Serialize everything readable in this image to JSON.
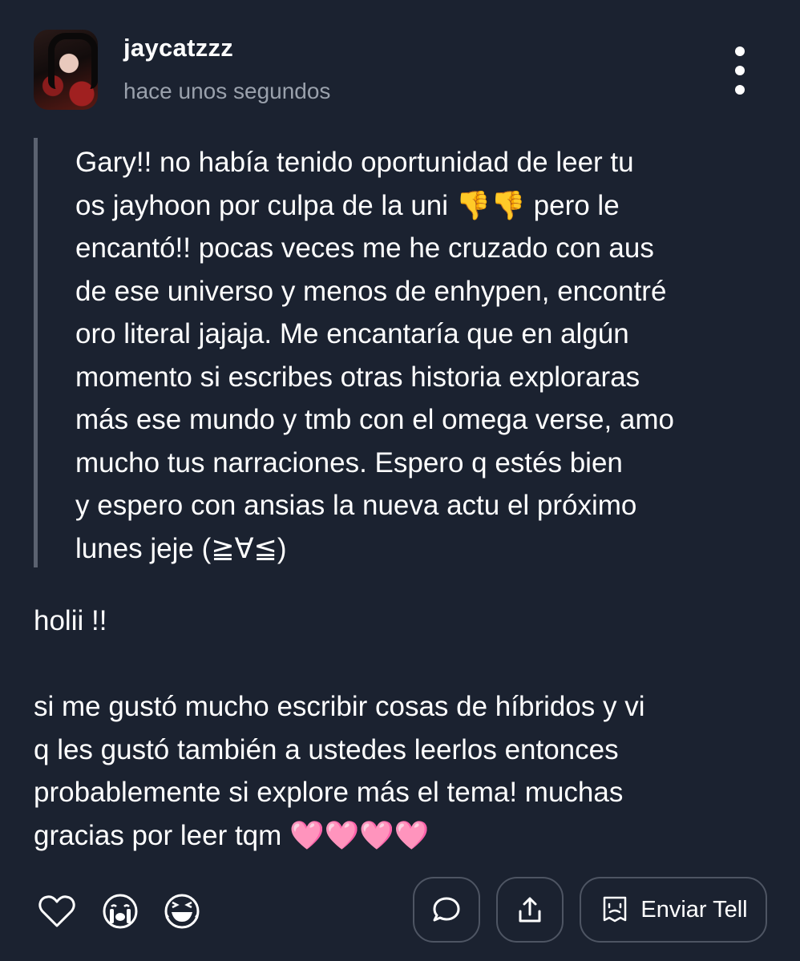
{
  "post": {
    "username": "jaycatzzz",
    "timestamp": "hace unos segundos"
  },
  "quoted_comment": {
    "text": "Gary!! no había tenido oportunidad de leer tu\nos jayhoon por culpa de la uni 👎👎 pero le\nencantó!! pocas veces me he cruzado con aus\nde ese universo y menos de enhypen, encontré\noro literal jajaja. Me encantaría que en algún\nmomento si escribes otras historia exploraras\nmás ese mundo y tmb con el omega verse, amo\nmucho tus narraciones. Espero q estés bien\ny espero con ansias la nueva actu el próximo\nlunes jeje (≧∀≦)"
  },
  "reply": {
    "text": "holii !!\n\nsi me gustó mucho escribir cosas de híbridos y vi\nq les gustó también a ustedes leerlos entonces\nprobablemente si explore más el tema! muchas\ngracias por leer tqm 🩷🩷🩷🩷"
  },
  "actions": {
    "send_label": "Enviar Tell",
    "icons": [
      "heart-icon",
      "crying-face-icon",
      "laughing-face-icon",
      "comment-icon",
      "share-icon",
      "tell-icon"
    ]
  },
  "colors": {
    "background": "#1b2230",
    "muted_text": "#9aa1ac",
    "quote_bar": "#5b6270",
    "button_border": "#4e5563"
  }
}
